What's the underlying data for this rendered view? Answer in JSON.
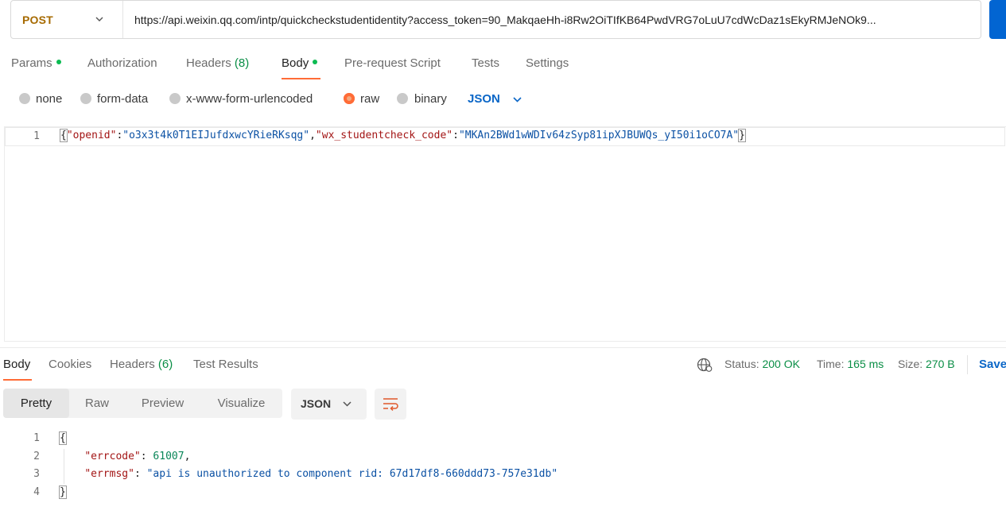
{
  "request": {
    "method": "POST",
    "url": "https://api.weixin.qq.com/intp/quickcheckstudentidentity?access_token=90_MakqaeHh-i8Rw2OiTIfKB64PwdVRG7oLuU7cdWcDaz1sEkyRMJeNOk9..."
  },
  "request_tabs": [
    {
      "label": "Params",
      "indicator": "dot"
    },
    {
      "label": "Authorization"
    },
    {
      "label": "Headers",
      "count": "(8)"
    },
    {
      "label": "Body",
      "indicator": "dot",
      "active": true
    },
    {
      "label": "Pre-request Script"
    },
    {
      "label": "Tests"
    },
    {
      "label": "Settings"
    }
  ],
  "body_types": [
    "none",
    "form-data",
    "x-www-form-urlencoded",
    "raw",
    "binary"
  ],
  "body_type_selected": "raw",
  "body_format": "JSON",
  "request_body": {
    "line_number": "1",
    "open": "{",
    "key1": "\"openid\"",
    "colon": ":",
    "val1": "\"o3x3t4k0T1EIJufdxwcYRieRKsqg\"",
    "comma": ",",
    "key2": "\"wx_studentcheck_code\"",
    "val2": "\"MKAn2BWd1wWDIv64zSyp81ipXJBUWQs_yI50i1oCO7A\"",
    "close": "}"
  },
  "response_tabs": [
    {
      "label": "Body",
      "active": true
    },
    {
      "label": "Cookies"
    },
    {
      "label": "Headers",
      "count": "(6)"
    },
    {
      "label": "Test Results"
    }
  ],
  "response_meta": {
    "status_label": "Status:",
    "status_value": "200 OK",
    "time_label": "Time:",
    "time_value": "165 ms",
    "size_label": "Size:",
    "size_value": "270 B",
    "save": "Save"
  },
  "view_modes": [
    "Pretty",
    "Raw",
    "Preview",
    "Visualize"
  ],
  "view_mode_selected": "Pretty",
  "response_format": "JSON",
  "response_body": {
    "lines": [
      "1",
      "2",
      "3",
      "4"
    ],
    "open": "{",
    "errcode_key": "\"errcode\"",
    "errcode_value": "61007",
    "errmsg_key": "\"errmsg\"",
    "errmsg_value": "\"api is unauthorized to component rid: 67d17df8-660ddd73-757e31db\"",
    "close": "}"
  },
  "colors": {
    "accent": "#ff6c37",
    "link": "#0a66c7",
    "success": "#0a8e46",
    "method": "#a66a00"
  },
  "icons": [
    "chevron-down-icon",
    "globe-icon",
    "wrap-lines-icon"
  ]
}
